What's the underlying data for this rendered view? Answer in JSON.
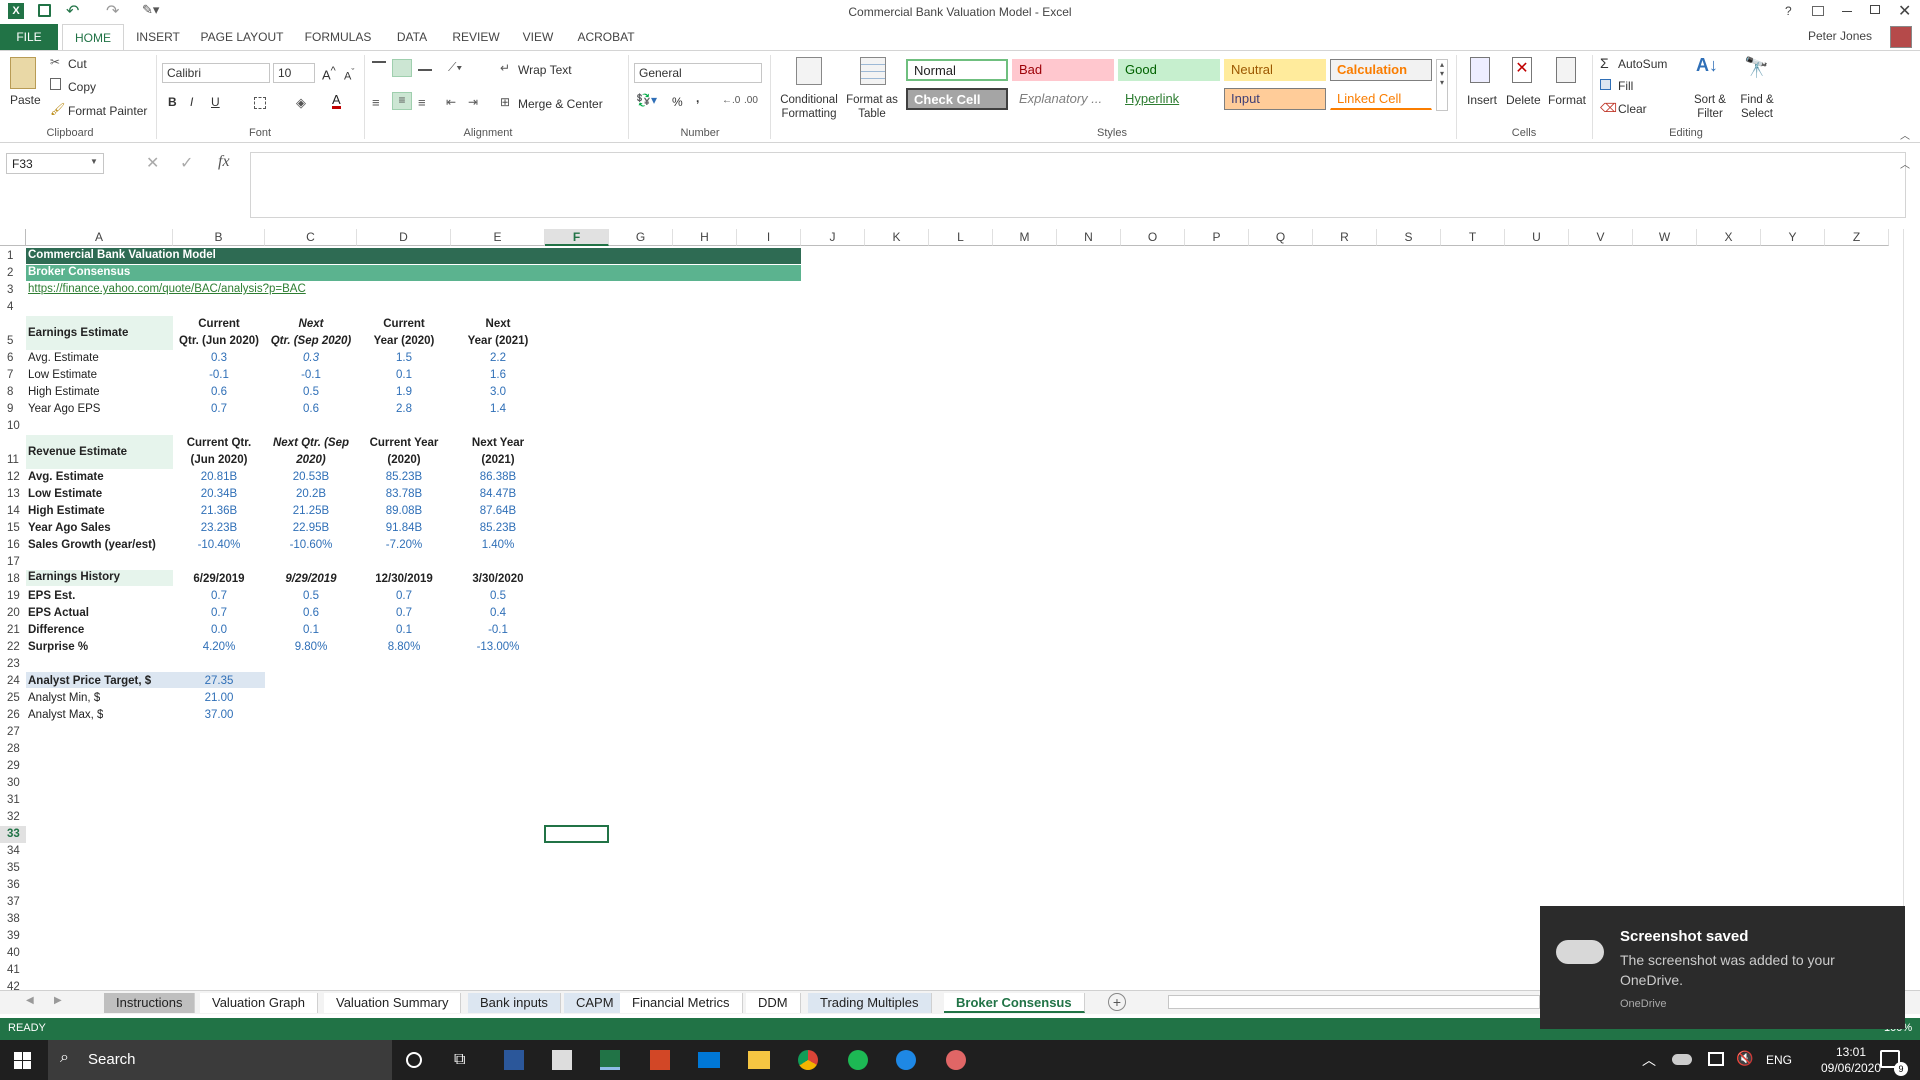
{
  "window": {
    "title": "Commercial Bank Valuation Model - Excel",
    "user": "Peter Jones",
    "help": "?"
  },
  "menu": {
    "file": "FILE",
    "tabs": [
      "HOME",
      "INSERT",
      "PAGE LAYOUT",
      "FORMULAS",
      "DATA",
      "REVIEW",
      "VIEW",
      "ACROBAT"
    ]
  },
  "ribbon": {
    "clipboard": {
      "paste": "Paste",
      "cut": "Cut",
      "copy": "Copy",
      "format_painter": "Format Painter",
      "group": "Clipboard"
    },
    "font": {
      "name": "Calibri",
      "size": "10",
      "bold": "B",
      "italic": "I",
      "underline": "U",
      "group": "Font"
    },
    "alignment": {
      "wrap": "Wrap Text",
      "merge": "Merge & Center",
      "group": "Alignment"
    },
    "number": {
      "format": "General",
      "percent": "%",
      "comma": ",",
      "group": "Number"
    },
    "styles": {
      "conditional": "Conditional Formatting",
      "format_table": "Format as Table",
      "group": "Styles",
      "boxes": [
        {
          "label": "Normal",
          "bg": "#ffffff",
          "fg": "#000000",
          "border": "#6fbf7f"
        },
        {
          "label": "Bad",
          "bg": "#ffc7ce",
          "fg": "#9c0006",
          "border": "#ffc7ce"
        },
        {
          "label": "Good",
          "bg": "#c6efce",
          "fg": "#006100",
          "border": "#c6efce"
        },
        {
          "label": "Neutral",
          "bg": "#ffeb9c",
          "fg": "#9c5700",
          "border": "#ffeb9c"
        },
        {
          "label": "Calculation",
          "bg": "#f2f2f2",
          "fg": "#fa7d00",
          "border": "#7f7f7f"
        },
        {
          "label": "Check Cell",
          "bg": "#a5a5a5",
          "fg": "#ffffff",
          "border": "#3f3f3f"
        },
        {
          "label": "Explanatory ...",
          "bg": "#ffffff",
          "fg": "#7f7f7f",
          "border": "#ffffff"
        },
        {
          "label": "Hyperlink",
          "bg": "#ffffff",
          "fg": "#2e7d32",
          "border": "#ffffff"
        },
        {
          "label": "Input",
          "bg": "#ffcc99",
          "fg": "#3f3f76",
          "border": "#7f7f7f"
        },
        {
          "label": "Linked Cell",
          "bg": "#ffffff",
          "fg": "#fa7d00",
          "border": "#ffffff"
        }
      ]
    },
    "cells": {
      "insert": "Insert",
      "delete": "Delete",
      "format": "Format",
      "group": "Cells"
    },
    "editing": {
      "autosum": "AutoSum",
      "fill": "Fill",
      "clear": "Clear",
      "sort": "Sort & Filter",
      "find": "Find & Select",
      "group": "Editing"
    }
  },
  "formula_bar": {
    "name_box": "F33",
    "fx": "fx",
    "content": ""
  },
  "columns": [
    "A",
    "B",
    "C",
    "D",
    "E",
    "F",
    "G",
    "H",
    "I",
    "J",
    "K",
    "L",
    "M",
    "N",
    "O",
    "P",
    "Q",
    "R",
    "S",
    "T",
    "U",
    "V",
    "W",
    "X",
    "Y",
    "Z"
  ],
  "sheet": {
    "title": "Commercial Bank Valuation Model",
    "subtitle": "Broker Consensus",
    "link": "https://finance.yahoo.com/quote/BAC/analysis?p=BAC",
    "earnings": {
      "label": "Earnings Estimate",
      "headers": [
        [
          "Current",
          "Qtr. (Jun 2020)"
        ],
        [
          "Next",
          "Qtr. (Sep 2020)"
        ],
        [
          "Current",
          "Year (2020)"
        ],
        [
          "Next",
          "Year (2021)"
        ]
      ],
      "rows": [
        {
          "label": "Avg. Estimate",
          "values": [
            "0.3",
            "0.3",
            "1.5",
            "2.2"
          ]
        },
        {
          "label": "Low Estimate",
          "values": [
            "-0.1",
            "-0.1",
            "0.1",
            "1.6"
          ]
        },
        {
          "label": "High Estimate",
          "values": [
            "0.6",
            "0.5",
            "1.9",
            "3.0"
          ]
        },
        {
          "label": "Year Ago EPS",
          "values": [
            "0.7",
            "0.6",
            "2.8",
            "1.4"
          ]
        }
      ]
    },
    "revenue": {
      "label": "Revenue Estimate",
      "headers": [
        [
          "Current Qtr.",
          "(Jun 2020)"
        ],
        [
          "Next Qtr. (Sep",
          "2020)"
        ],
        [
          "Current Year",
          "(2020)"
        ],
        [
          "Next Year",
          "(2021)"
        ]
      ],
      "rows": [
        {
          "label": "Avg. Estimate",
          "values": [
            "20.81B",
            "20.53B",
            "85.23B",
            "86.38B"
          ]
        },
        {
          "label": "Low Estimate",
          "values": [
            "20.34B",
            "20.2B",
            "83.78B",
            "84.47B"
          ]
        },
        {
          "label": "High Estimate",
          "values": [
            "21.36B",
            "21.25B",
            "89.08B",
            "87.64B"
          ]
        },
        {
          "label": "Year Ago Sales",
          "values": [
            "23.23B",
            "22.95B",
            "91.84B",
            "85.23B"
          ]
        },
        {
          "label": "Sales Growth (year/est)",
          "values": [
            "-10.40%",
            "-10.60%",
            "-7.20%",
            "1.40%"
          ]
        }
      ]
    },
    "history": {
      "label": "Earnings History",
      "headers": [
        "6/29/2019",
        "9/29/2019",
        "12/30/2019",
        "3/30/2020"
      ],
      "rows": [
        {
          "label": "EPS Est.",
          "values": [
            "0.7",
            "0.5",
            "0.7",
            "0.5"
          ]
        },
        {
          "label": "EPS Actual",
          "values": [
            "0.7",
            "0.6",
            "0.7",
            "0.4"
          ]
        },
        {
          "label": "Difference",
          "values": [
            "0.0",
            "0.1",
            "0.1",
            "-0.1"
          ]
        },
        {
          "label": "Surprise %",
          "values": [
            "4.20%",
            "9.80%",
            "8.80%",
            "-13.00%"
          ]
        }
      ]
    },
    "price": [
      {
        "label": "Analyst Price Target, $",
        "value": "27.35"
      },
      {
        "label": "Analyst Min, $",
        "value": "21.00"
      },
      {
        "label": "Analyst Max, $",
        "value": "37.00"
      }
    ]
  },
  "sheet_tabs": [
    {
      "label": "Instructions",
      "bg": "#bfbfbf"
    },
    {
      "label": "Valuation Graph",
      "bg": "#ffffff"
    },
    {
      "label": "Valuation Summary",
      "bg": "#ffffff"
    },
    {
      "label": "Bank inputs",
      "bg": "#dce6f1"
    },
    {
      "label": "CAPM",
      "bg": "#dce6f1"
    },
    {
      "label": "Financial Metrics",
      "bg": "#ffffff"
    },
    {
      "label": "DDM",
      "bg": "#ffffff"
    },
    {
      "label": "Trading Multiples",
      "bg": "#dce6f1"
    },
    {
      "label": "Broker Consensus",
      "bg": "#ffffff"
    }
  ],
  "status": {
    "ready": "READY",
    "zoom": "100%"
  },
  "taskbar": {
    "search": "Search",
    "lang": "ENG",
    "time": "13:01",
    "date": "09/06/2020",
    "notif_count": "9"
  },
  "toast": {
    "title": "Screenshot saved",
    "body": "The screenshot was added to your OneDrive.",
    "source": "OneDrive"
  }
}
